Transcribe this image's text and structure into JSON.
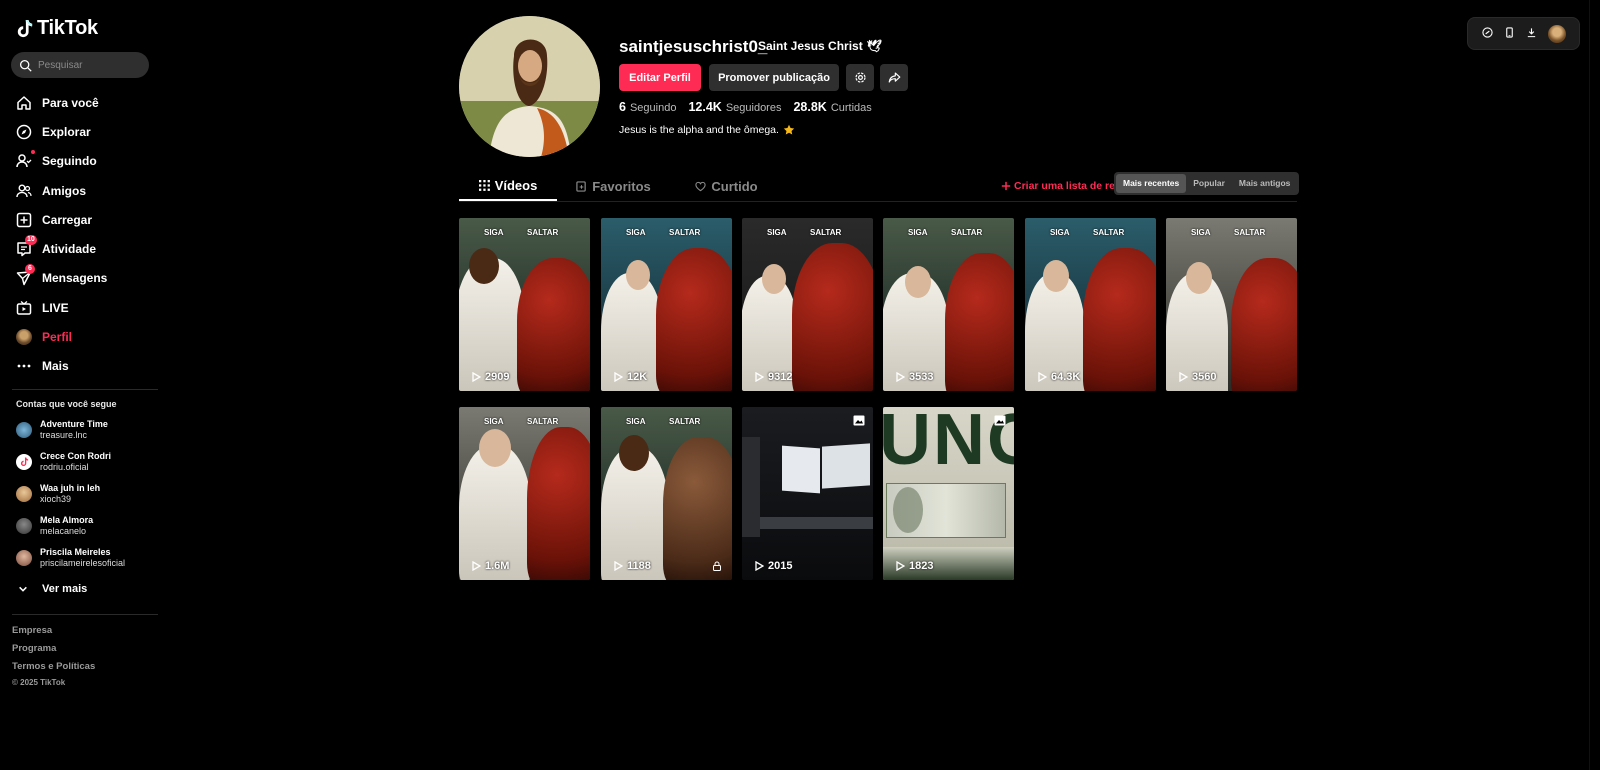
{
  "app": {
    "logo_text": "TikTok",
    "brand_color": "#fe2c55"
  },
  "search": {
    "placeholder": "Pesquisar"
  },
  "nav": [
    {
      "label": "Para você",
      "icon": "home-icon"
    },
    {
      "label": "Explorar",
      "icon": "compass-icon"
    },
    {
      "label": "Seguindo",
      "icon": "following-icon"
    },
    {
      "label": "Amigos",
      "icon": "friends-icon"
    },
    {
      "label": "Carregar",
      "icon": "upload-icon"
    },
    {
      "label": "Atividade",
      "icon": "activity-icon",
      "badge": "10"
    },
    {
      "label": "Mensagens",
      "icon": "messages-icon",
      "badge": "6"
    },
    {
      "label": "LIVE",
      "icon": "live-icon"
    },
    {
      "label": "Perfil",
      "icon": "avatar"
    },
    {
      "label": "Mais",
      "icon": "more-icon"
    }
  ],
  "following": {
    "title": "Contas que você segue",
    "accounts": [
      {
        "name": "Adventure Time",
        "handle": "treasure.lnc"
      },
      {
        "name": "Crece Con Rodri",
        "handle": "rodriu.oficial"
      },
      {
        "name": "Waa juh in leh",
        "handle": "xioch39"
      },
      {
        "name": "Mela Almora",
        "handle": "melacanelo"
      },
      {
        "name": "Priscila Meireles",
        "handle": "priscilameirelesoficial"
      }
    ],
    "see_more": "Ver mais"
  },
  "footer": {
    "links": [
      "Empresa",
      "Programa",
      "Termos e Políticas"
    ],
    "copyright": "© 2025 TikTok"
  },
  "profile": {
    "username": "saintjesuschrist0_",
    "display_name": "Saint Jesus Christ",
    "edit_button": "Editar Perfil",
    "promote_button": "Promover publicação",
    "stats": [
      {
        "value": "6",
        "label": "Seguindo"
      },
      {
        "value": "12.4K",
        "label": "Seguidores"
      },
      {
        "value": "28.8K",
        "label": "Curtidas"
      }
    ],
    "bio": "Jesus is the alpha and the ômega."
  },
  "tabs": [
    "Vídeos",
    "Favoritos",
    "Curtido"
  ],
  "playlist_link": "Criar uma lista de reprodução",
  "sort": {
    "options": [
      "Mais recentes",
      "Popular",
      "Mais antigos"
    ],
    "selected": "Mais recentes"
  },
  "videos": [
    {
      "views": "2909",
      "label_left": "SIGA",
      "label_right": "SALTAR"
    },
    {
      "views": "12K",
      "label_left": "SIGA",
      "label_right": "SALTAR"
    },
    {
      "views": "9312",
      "label_left": "SIGA",
      "label_right": "SALTAR"
    },
    {
      "views": "3533",
      "label_left": "SIGA",
      "label_right": "SALTAR"
    },
    {
      "views": "64.3K",
      "label_left": "SIGA",
      "label_right": "SALTAR"
    },
    {
      "views": "3560",
      "label_left": "SIGA",
      "label_right": "SALTAR"
    },
    {
      "views": "1.6M",
      "label_left": "SIGA",
      "label_right": "SALTAR"
    },
    {
      "views": "1188",
      "label_left": "SIGA",
      "label_right": "SALTAR",
      "locked": true
    },
    {
      "views": "2015",
      "photo_icon": true
    },
    {
      "views": "1823",
      "photo_icon": true,
      "overlay_text": "UNG"
    }
  ]
}
